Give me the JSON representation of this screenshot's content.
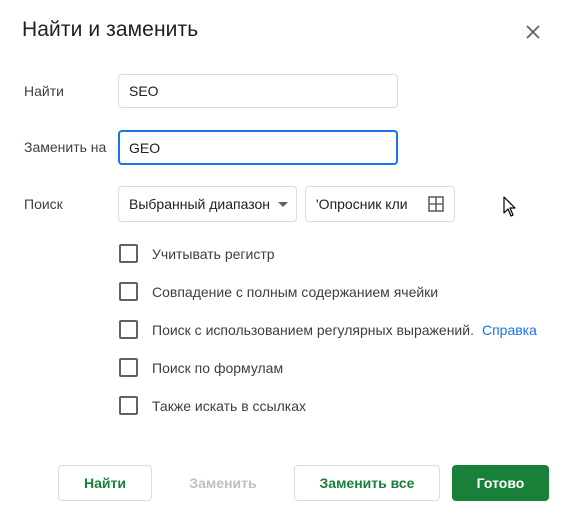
{
  "dialog": {
    "title": "Найти и заменить",
    "close_icon": "close-icon"
  },
  "find": {
    "label": "Найти",
    "value": "SEO"
  },
  "replace": {
    "label": "Заменить на",
    "value": "GEO"
  },
  "search": {
    "label": "Поиск",
    "scope_value": "Выбранный диапазон",
    "range_value": "'Опросник кли",
    "range_icon": "grid-icon"
  },
  "options": [
    {
      "label": "Учитывать регистр",
      "checked": false
    },
    {
      "label": "Совпадение с полным содержанием ячейки",
      "checked": false
    },
    {
      "label": "Поиск с использованием регулярных выражений.",
      "checked": false,
      "help": "Справка"
    },
    {
      "label": "Поиск по формулам",
      "checked": false
    },
    {
      "label": "Также искать в ссылках",
      "checked": false
    }
  ],
  "buttons": {
    "find": "Найти",
    "replace": "Заменить",
    "replace_all": "Заменить все",
    "done": "Готово"
  },
  "colors": {
    "accent": "#1a73e8",
    "primary_button": "#188038"
  }
}
